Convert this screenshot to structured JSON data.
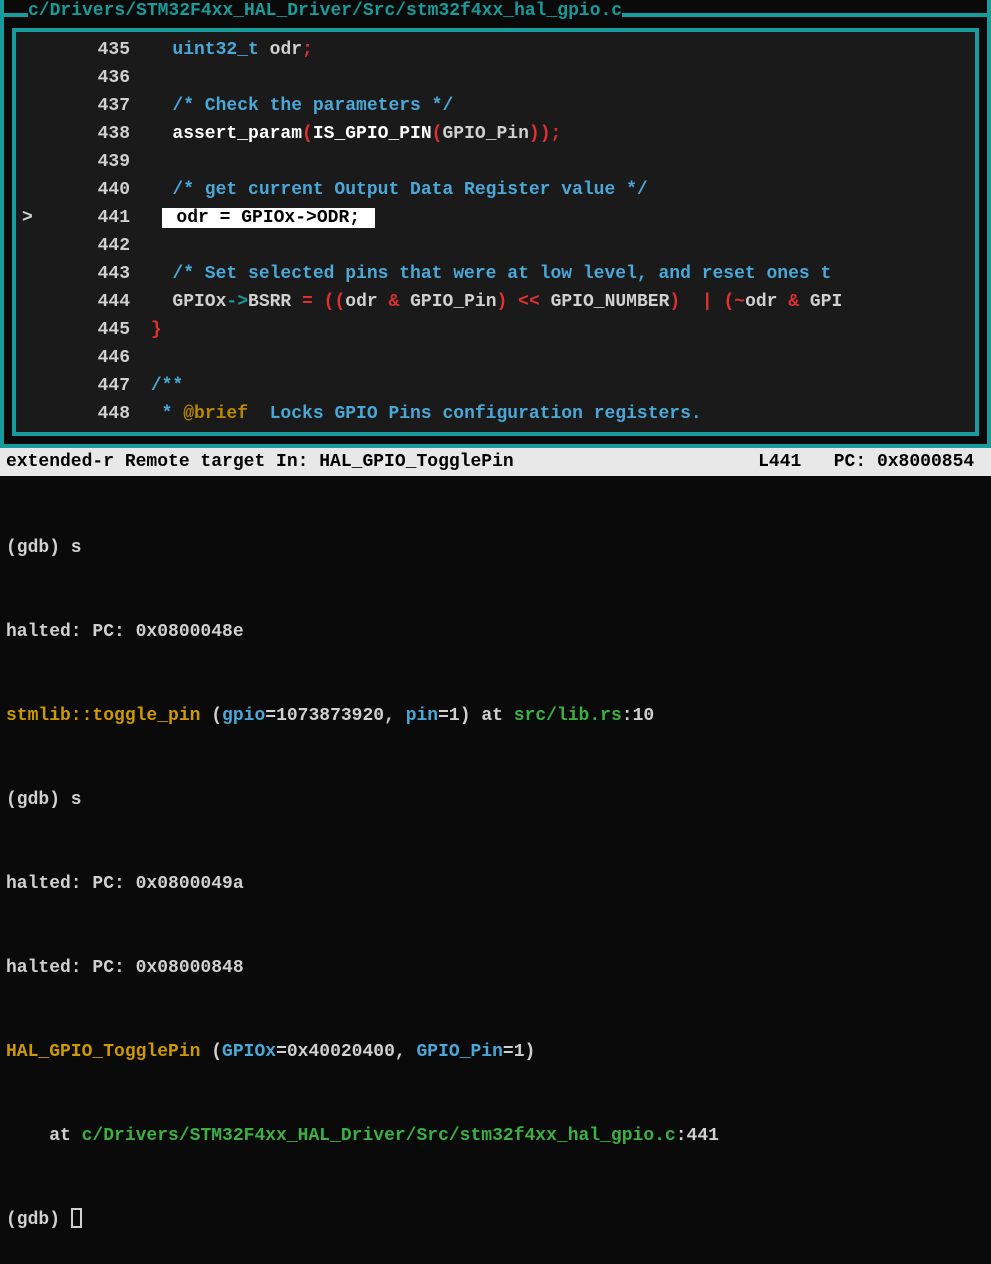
{
  "file_path": "c/Drivers/STM32F4xx_HAL_Driver/Src/stm32f4xx_hal_gpio.c",
  "lines": {
    "l435": {
      "num": "435",
      "type": "uint32_t",
      "ident": "odr",
      "semi": ";"
    },
    "l436": {
      "num": "436"
    },
    "l437": {
      "num": "437",
      "comment": "/* Check the parameters */"
    },
    "l438": {
      "num": "438",
      "fn": "assert_param",
      "lp": "(",
      "inner": "IS_GPIO_PIN",
      "lp2": "(",
      "arg": "GPIO_Pin",
      "rp": "))",
      "semi": ";"
    },
    "l439": {
      "num": "439"
    },
    "l440": {
      "num": "440",
      "comment": "/* get current Output Data Register value */"
    },
    "l441": {
      "num": "441",
      "marker": ">",
      "code": " odr = GPIOx->ODR; "
    },
    "l442": {
      "num": "442"
    },
    "l443": {
      "num": "443",
      "comment": "/* Set selected pins that were at low level, and reset ones t"
    },
    "l444": {
      "num": "444",
      "a": "GPIOx",
      "arrow": "->",
      "b": "BSRR ",
      "eq": "=",
      "c": " ",
      "lp": "((",
      "d": "odr ",
      "amp": "&",
      "e": " GPIO_Pin",
      "rp": ")",
      "sp": " ",
      "shl": "<<",
      "f": " GPIO_NUMBER",
      "rp2": ")",
      "sp2": "  ",
      "pipe": "|",
      "sp3": " ",
      "lp3": "(",
      "not": "~",
      "g": "odr ",
      "amp2": "&",
      "h": " GPI"
    },
    "l445": {
      "num": "445",
      "brace": "}"
    },
    "l446": {
      "num": "446"
    },
    "l447": {
      "num": "447",
      "comment": "/**"
    },
    "l448": {
      "num": "448",
      "pre": "  * ",
      "tag": "@brief",
      "post": "  Locks GPIO Pins configuration registers."
    }
  },
  "status": {
    "left": "extended-r Remote target In: HAL_GPIO_TogglePin",
    "line": "L441",
    "pc": "PC: 0x8000854"
  },
  "console": {
    "c1": "(gdb) s",
    "c2": "halted: PC: 0x0800048e",
    "c3_fn": "stmlib::toggle_pin",
    "c3_a": " (",
    "c3_p1": "gpio",
    "c3_b": "=1073873920, ",
    "c3_p2": "pin",
    "c3_c": "=1) at ",
    "c3_path": "src/lib.rs",
    "c3_d": ":10",
    "c4": "(gdb) s",
    "c5": "halted: PC: 0x0800049a",
    "c6": "halted: PC: 0x08000848",
    "c7_fn": "HAL_GPIO_TogglePin",
    "c7_a": " (",
    "c7_p1": "GPIOx",
    "c7_b": "=0x40020400, ",
    "c7_p2": "GPIO_Pin",
    "c7_c": "=1)",
    "c8_a": "    at ",
    "c8_path": "c/Drivers/STM32F4xx_HAL_Driver/Src/stm32f4xx_hal_gpio.c",
    "c8_b": ":441",
    "c9": "(gdb) "
  }
}
